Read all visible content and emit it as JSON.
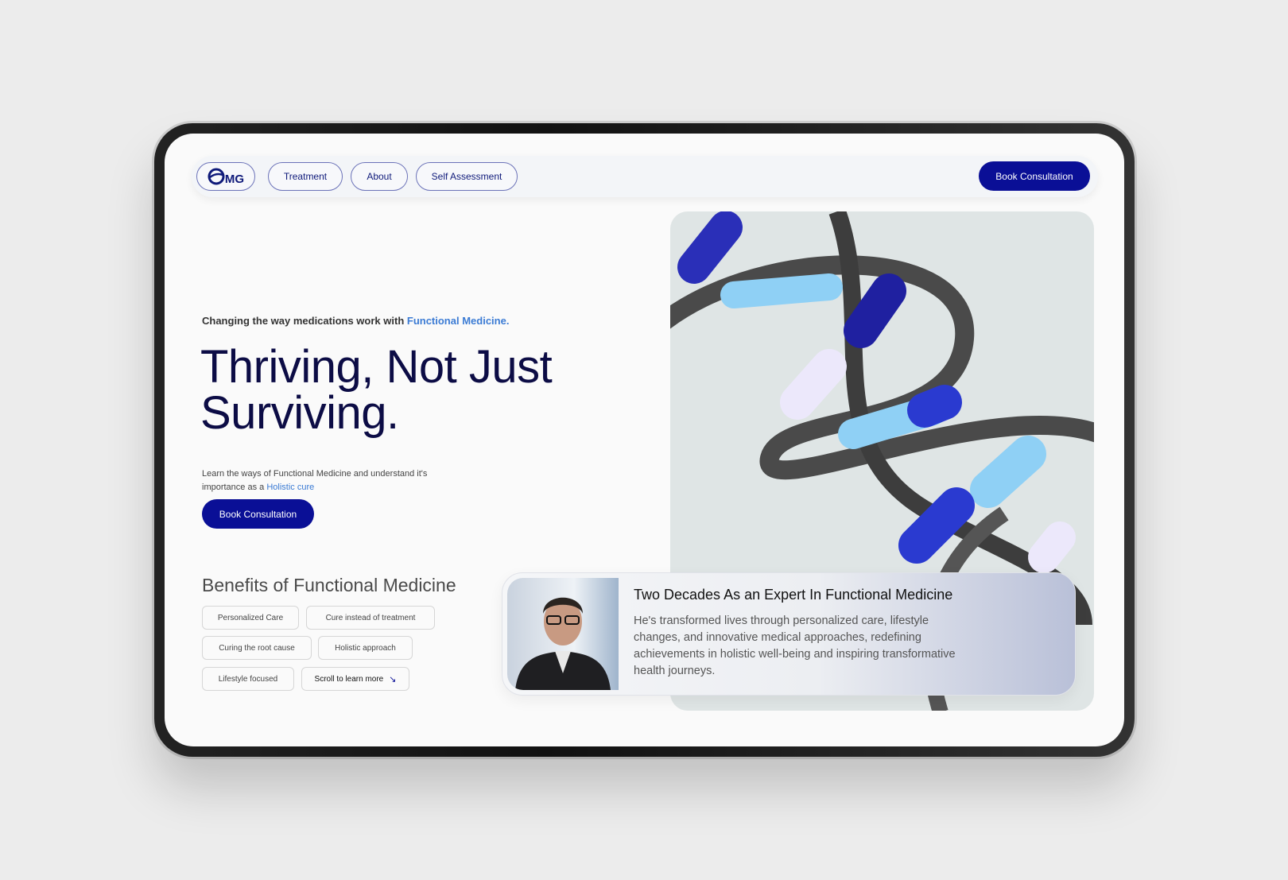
{
  "nav": {
    "logo": "MG",
    "items": [
      "Treatment",
      "About",
      "Self Assessment"
    ],
    "cta": "Book Consultation"
  },
  "hero": {
    "eyebrow": "Changing the way medications work with ",
    "eyebrow_link": "Functional Medicine.",
    "title_line1": "Thriving, Not Just",
    "title_line2": "Surviving.",
    "desc": "Learn the ways of Functional Medicine and understand it's importance as a ",
    "desc_link": "Holistic cure",
    "cta": "Book Consultation"
  },
  "benefits": {
    "title": "Benefits of Functional Medicine",
    "tags": [
      "Personalized Care",
      "Cure instead of  treatment",
      "Curing the root cause",
      "Holistic approach",
      "Lifestyle focused"
    ],
    "scroll": "Scroll to learn more",
    "scroll_icon": "arrow-down-right-icon"
  },
  "card": {
    "title": "Two Decades As an Expert In Functional Medicine",
    "text": "He's transformed lives through personalized care, lifestyle changes, and innovative medical approaches, redefining achievements in holistic well-being and inspiring transformative health journeys."
  },
  "colors": {
    "brand": "#0a0f96",
    "link": "#3b7bd4",
    "heading": "#0c0c45"
  }
}
